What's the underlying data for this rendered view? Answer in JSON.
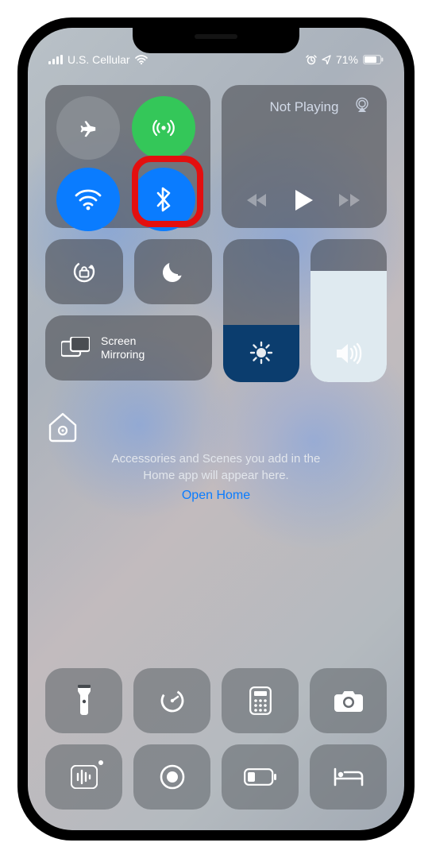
{
  "status": {
    "carrier": "U.S. Cellular",
    "battery_pct": "71%"
  },
  "connectivity": {
    "airplane_on": false,
    "cellular_on": true,
    "wifi_on": true,
    "bluetooth_on": true
  },
  "music": {
    "title": "Not Playing"
  },
  "screen_mirroring": {
    "label": "Screen\nMirroring"
  },
  "orientation_locked": false,
  "dnd_on": false,
  "brightness": {
    "value": 0.4
  },
  "volume": {
    "value": 0.78
  },
  "home": {
    "desc": "Accessories and Scenes you add in the Home app will appear here.",
    "link": "Open Home"
  },
  "highlight": {
    "target": "bluetooth"
  }
}
